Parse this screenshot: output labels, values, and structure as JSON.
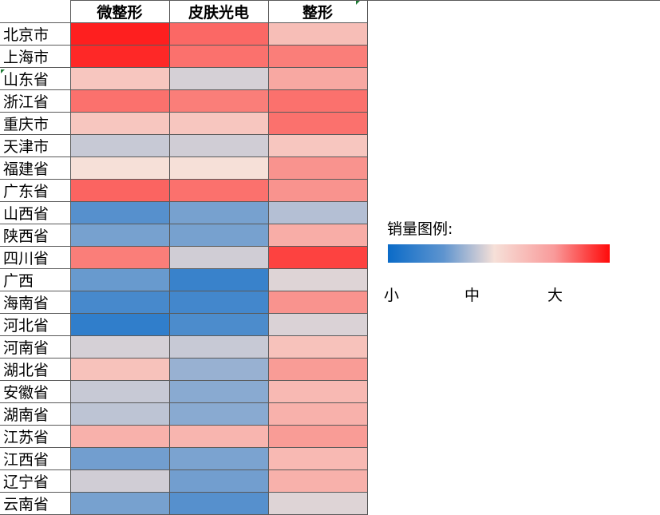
{
  "legend": {
    "title": "销量图例:",
    "min_label": "小",
    "mid_label": "中",
    "max_label": "大"
  },
  "chart_data": {
    "type": "heatmap",
    "columns": [
      "微整形",
      "皮肤光电",
      "整形"
    ],
    "rows": [
      "北京市",
      "上海市",
      "山东省",
      "浙江省",
      "重庆市",
      "天津市",
      "福建省",
      "广东省",
      "山西省",
      "陕西省",
      "四川省",
      "广西",
      "海南省",
      "河北省",
      "河南省",
      "湖北省",
      "安徽省",
      "湖南省",
      "江苏省",
      "江西省",
      "辽宁省",
      "云南省"
    ],
    "values": [
      [
        95,
        78,
        58
      ],
      [
        93,
        76,
        73
      ],
      [
        56,
        43,
        63
      ],
      [
        76,
        73,
        76
      ],
      [
        56,
        56,
        76
      ],
      [
        40,
        42,
        56
      ],
      [
        50,
        50,
        68
      ],
      [
        79,
        76,
        68
      ],
      [
        16,
        23,
        36
      ],
      [
        23,
        23,
        62
      ],
      [
        73,
        42,
        87
      ],
      [
        20,
        10,
        45
      ],
      [
        13,
        12,
        68
      ],
      [
        8,
        14,
        44
      ],
      [
        43,
        40,
        57
      ],
      [
        57,
        30,
        66
      ],
      [
        40,
        27,
        59
      ],
      [
        38,
        27,
        61
      ],
      [
        61,
        60,
        66
      ],
      [
        22,
        24,
        59
      ],
      [
        42,
        22,
        61
      ],
      [
        23,
        16,
        45
      ]
    ],
    "scale": {
      "min": 0,
      "max": 100,
      "colors": [
        "#0a6bc8",
        "#f6e0d8",
        "#ff0a0a"
      ]
    }
  }
}
